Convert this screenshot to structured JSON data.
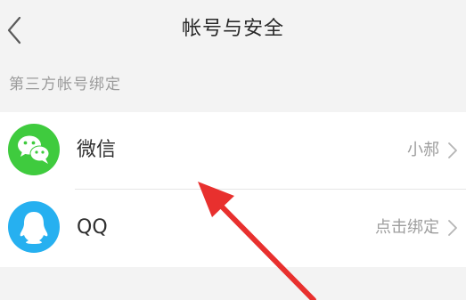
{
  "header": {
    "title": "帐号与安全",
    "back_icon": "chevron-left-icon"
  },
  "section": {
    "title": "第三方帐号绑定"
  },
  "accounts": [
    {
      "label": "微信",
      "value": "小郝",
      "icon": "wechat-icon",
      "icon_color": "#3fcb3e",
      "chevron_icon": "chevron-right-icon"
    },
    {
      "label": "QQ",
      "value": "点击绑定",
      "icon": "qq-icon",
      "icon_color": "#26b0f0",
      "chevron_icon": "chevron-right-icon"
    }
  ],
  "colors": {
    "background": "#f3f3f3",
    "card": "#ffffff",
    "annotation_arrow": "#e8302e"
  }
}
